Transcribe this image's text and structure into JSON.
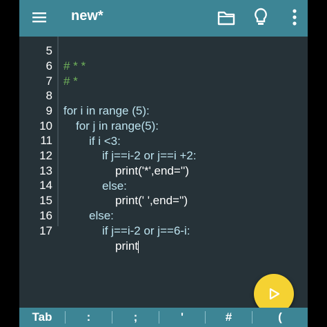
{
  "header": {
    "title": "new*"
  },
  "icons": {
    "menu": "hamburger-menu-icon",
    "folder": "folder-icon",
    "bulb": "lightbulb-icon",
    "more": "more-vertical-icon",
    "run": "play-icon"
  },
  "colors": {
    "toolbar": "#3d8595",
    "editor_bg": "#263238",
    "keyword": "#bde3ef",
    "comment": "#71b35b",
    "fab": "#f5d232"
  },
  "editor": {
    "lines": [
      {
        "num": "5",
        "code": "# * *",
        "kind": "comment"
      },
      {
        "num": "6",
        "code": "# *",
        "kind": "comment"
      },
      {
        "num": "7",
        "code": "",
        "kind": "code"
      },
      {
        "num": "8",
        "code": "for i in range (5):",
        "kind": "code"
      },
      {
        "num": "9",
        "code": "for j in range(5):",
        "kind": "code"
      },
      {
        "num": "10",
        "code": "if i <3:",
        "kind": "code"
      },
      {
        "num": "11",
        "code": "if j==i-2 or j==i +2:",
        "kind": "code"
      },
      {
        "num": "12",
        "code": "print('*',end='')",
        "kind": "code"
      },
      {
        "num": "13",
        "code": "else:",
        "kind": "code"
      },
      {
        "num": "14",
        "code": "print(' ',end='')",
        "kind": "code"
      },
      {
        "num": "15",
        "code": "else:",
        "kind": "code"
      },
      {
        "num": "16",
        "code": "if j==i-2 or j==6-i:",
        "kind": "code"
      },
      {
        "num": "17",
        "code": "print",
        "kind": "code"
      }
    ]
  },
  "keys": [
    "Tab",
    ":",
    ";",
    "'",
    "#",
    "("
  ]
}
